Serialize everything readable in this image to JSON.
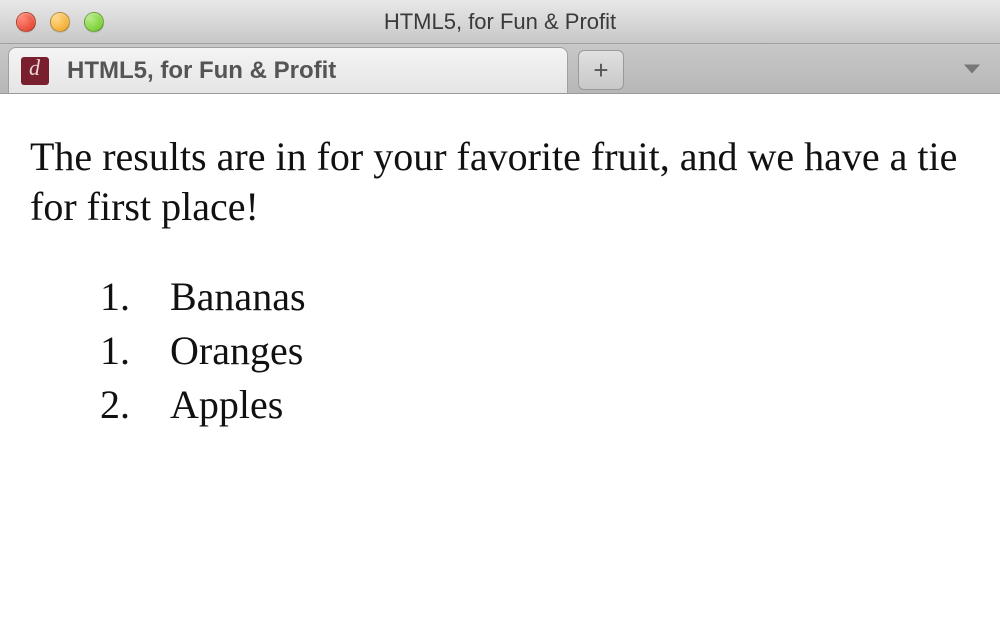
{
  "window": {
    "title": "HTML5, for Fun & Profit"
  },
  "tabs": {
    "active": {
      "title": "HTML5, for Fun & Profit",
      "favicon": "d-logo"
    },
    "new_tab_label": "+"
  },
  "content": {
    "intro": "The results are in for your favorite fruit, and we have a tie for first place!",
    "list_items": [
      {
        "marker": "1.",
        "text": "Bananas"
      },
      {
        "marker": "1.",
        "text": "Oranges"
      },
      {
        "marker": "2.",
        "text": "Apples"
      }
    ]
  }
}
